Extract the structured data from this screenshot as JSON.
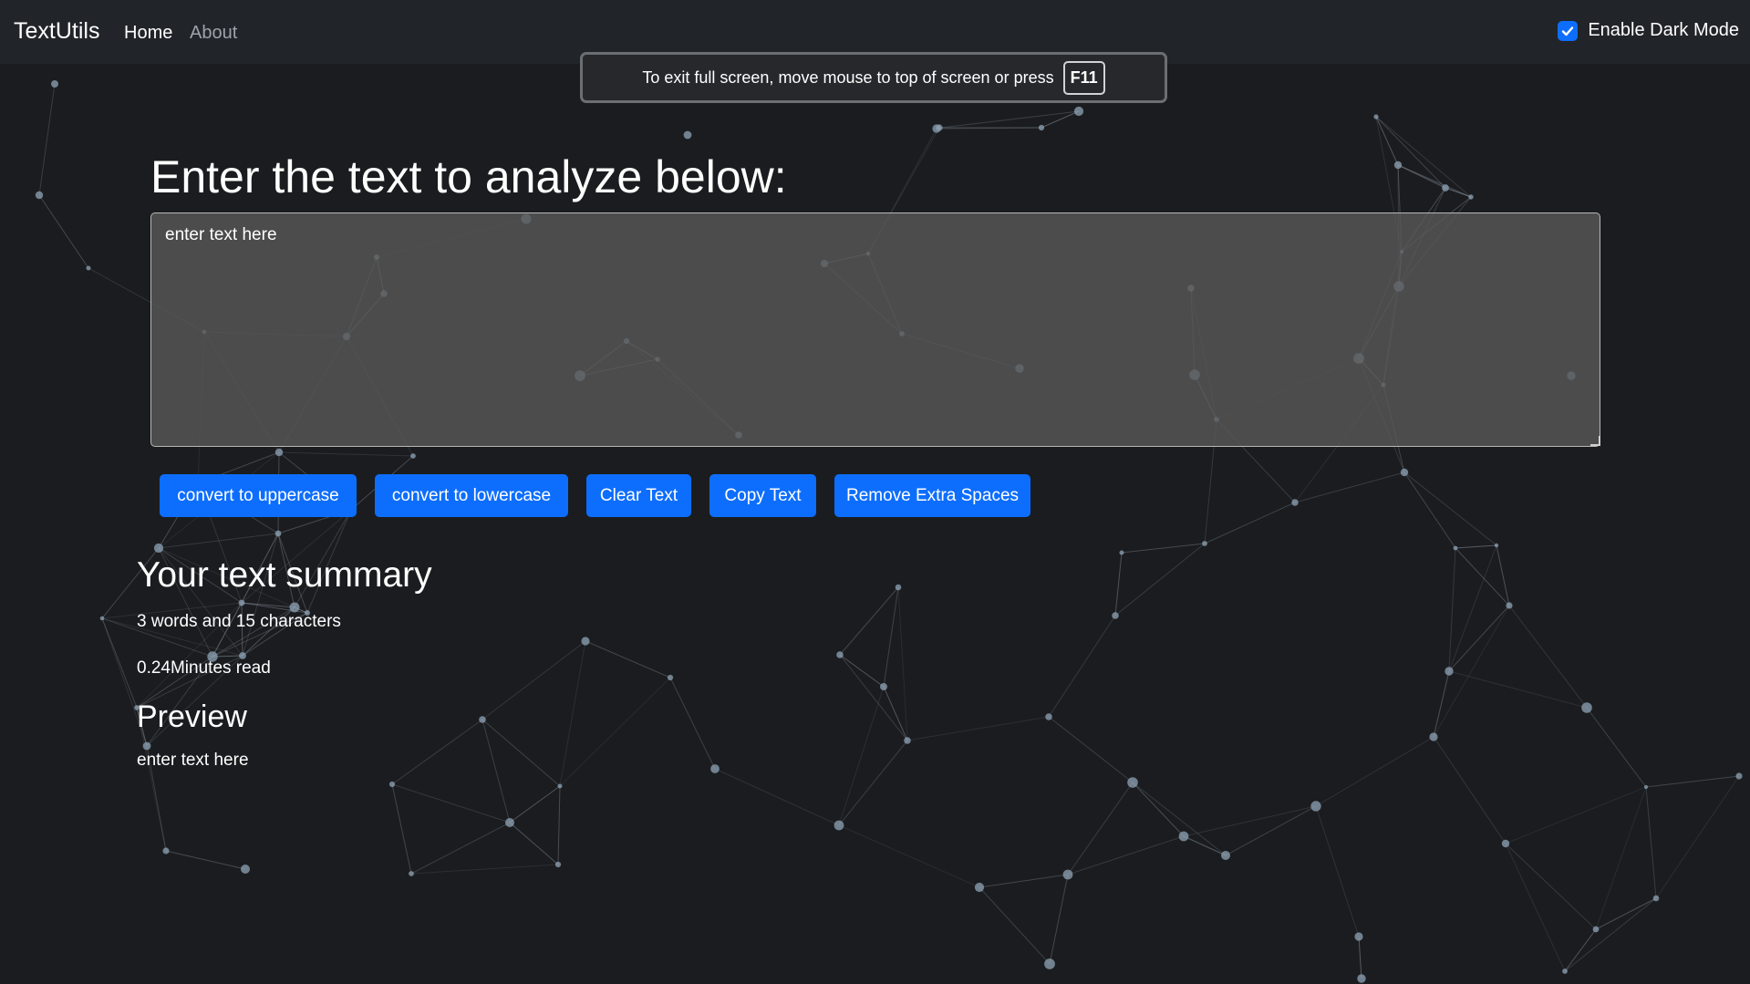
{
  "navbar": {
    "brand": "TextUtils",
    "links": [
      {
        "label": "Home",
        "active": true
      },
      {
        "label": "About",
        "active": false
      }
    ],
    "dark_mode": {
      "label": "Enable Dark Mode",
      "checked": true
    }
  },
  "fullscreen_notice": {
    "text": "To exit full screen, move mouse to top of screen or press",
    "key": "F11"
  },
  "form": {
    "heading": "Enter the text to analyze below:",
    "textarea_value": "enter text here"
  },
  "buttons": {
    "uppercase": "convert to uppercase",
    "lowercase": "convert to lowercase",
    "clear": "Clear Text",
    "copy": "Copy Text",
    "remove_spaces": "Remove Extra Spaces"
  },
  "summary": {
    "title": "Your text summary",
    "words_line": "3 words and 15 characters",
    "read_time": "0.24Minutes read"
  },
  "preview": {
    "title": "Preview",
    "text": "enter text here"
  },
  "colors": {
    "background": "#1b1c1f",
    "navbar": "#212429",
    "accent": "#0d6efd",
    "particle": "#8fa3b5"
  }
}
